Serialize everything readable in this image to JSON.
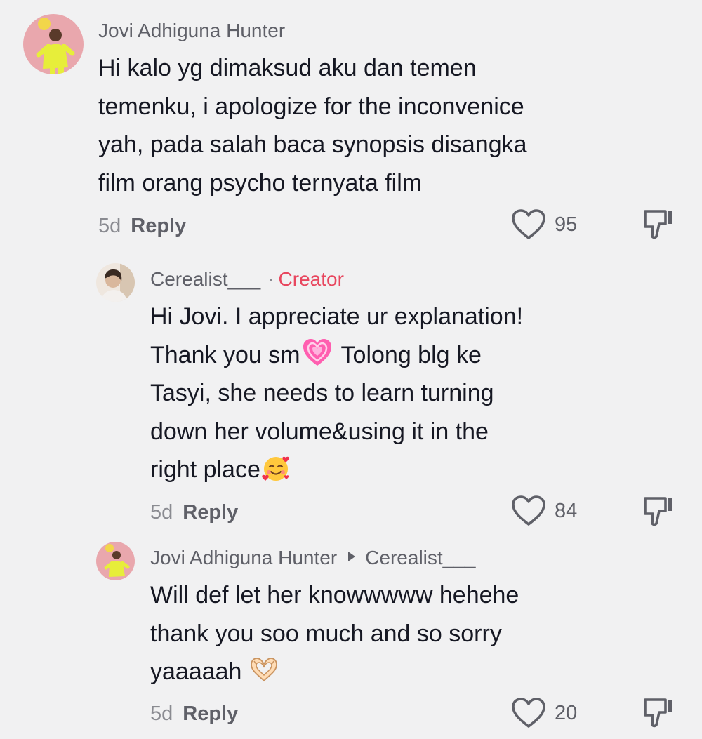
{
  "comments": [
    {
      "username": "Jovi Adhiguna Hunter",
      "lines": [
        "Hi kalo yg dimaksud aku dan temen",
        "temenku, i apologize for the inconvenice",
        "yah, pada salah baca synopsis disangka",
        "film orang psycho ternyata film"
      ],
      "time": "5d",
      "reply": "Reply",
      "likes": "95"
    },
    {
      "username": "Cerealist___",
      "separator": "·",
      "badge": "Creator",
      "lines": [
        "Hi Jovi. I appreciate ur explanation!",
        "Thank you sm",
        "Tolong blg ke",
        "Tasyi, she needs to learn turning",
        "down her volume&using it in the",
        "right place"
      ],
      "time": "5d",
      "reply": "Reply",
      "likes": "84"
    },
    {
      "username": "Jovi Adhiguna Hunter",
      "reply_to": "Cerealist___",
      "lines": [
        "Will def let her knowwwww hehehe",
        "thank you soo much and so sorry",
        "yaaaaah"
      ],
      "time": "5d",
      "reply": "Reply",
      "likes": "20"
    }
  ],
  "icons": {
    "like": "heart-outline-icon",
    "dislike": "thumbs-down-icon",
    "emoji_heart": "growing-heart-emoji",
    "emoji_smile": "smiling-face-with-hearts-emoji",
    "emoji_hands": "heart-hands-emoji"
  },
  "colors": {
    "background": "#f1f1f2",
    "creator_badge": "#e8475f",
    "text": "#161823",
    "secondary": "#5f6068"
  }
}
